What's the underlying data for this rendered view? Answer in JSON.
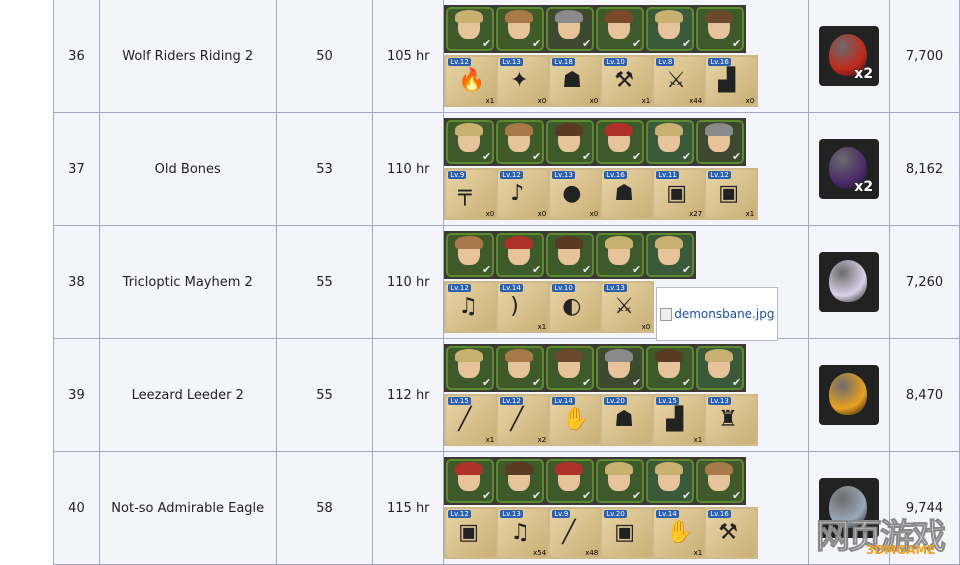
{
  "rows": [
    {
      "no": "36",
      "name": "Wolf Riders Riding 2",
      "level": "50",
      "time": "105 hr",
      "gold": "7,700",
      "heroes": [
        {
          "hair": "#c8b070",
          "bg": "#3f5a2a"
        },
        {
          "hair": "#a87a4a",
          "bg": "#405a2a"
        },
        {
          "hair": "#8a8a8a",
          "bg": "#3e4a30"
        },
        {
          "hair": "#7a4a2a",
          "bg": "#3f5a2a"
        },
        {
          "hair": "#c8b070",
          "bg": "#3a5a3a"
        },
        {
          "hair": "#6a4a2a",
          "bg": "#3f5a2a"
        }
      ],
      "items": [
        {
          "lv": "Lv.12",
          "icon": "flame-wand-icon",
          "glyph": "🔥",
          "qty": "x1"
        },
        {
          "lv": "Lv.13",
          "icon": "ice-wand-icon",
          "glyph": "✦",
          "qty": "x0"
        },
        {
          "lv": "Lv.18",
          "icon": "horned-helmet-icon",
          "glyph": "☗",
          "qty": "x0"
        },
        {
          "lv": "Lv.10",
          "icon": "battle-axe-icon",
          "glyph": "⚒",
          "qty": "x1"
        },
        {
          "lv": "Lv.8",
          "icon": "double-axe-icon",
          "glyph": "⚔",
          "qty": "x44"
        },
        {
          "lv": "Lv.16",
          "icon": "leather-boots-icon",
          "glyph": "▟",
          "qty": "x0"
        }
      ],
      "reward": {
        "icon": "red-crystal-icon",
        "color": "#c0281a",
        "mult": "x2"
      }
    },
    {
      "no": "37",
      "name": "Old Bones",
      "level": "53",
      "time": "110 hr",
      "gold": "8,162",
      "heroes": [
        {
          "hair": "#c8b070",
          "bg": "#3f5a2a"
        },
        {
          "hair": "#a87a4a",
          "bg": "#405a2a"
        },
        {
          "hair": "#5a3a20",
          "bg": "#3f5a2a"
        },
        {
          "hair": "#b0302a",
          "bg": "#3f5a2a"
        },
        {
          "hair": "#c8b070",
          "bg": "#3a5a3a"
        },
        {
          "hair": "#8a8a8a",
          "bg": "#3e4a30"
        }
      ],
      "items": [
        {
          "lv": "Lv.9",
          "icon": "pistol-icon",
          "glyph": "╤",
          "qty": "x0"
        },
        {
          "lv": "Lv.12",
          "icon": "lute-icon",
          "glyph": "♪",
          "qty": "x0"
        },
        {
          "lv": "Lv.13",
          "icon": "orb-staff-icon",
          "glyph": "●",
          "qty": "x0"
        },
        {
          "lv": "Lv.16",
          "icon": "golden-helmet-icon",
          "glyph": "☗",
          "qty": ""
        },
        {
          "lv": "Lv.11",
          "icon": "steel-armor-icon",
          "glyph": "▣",
          "qty": "x27"
        },
        {
          "lv": "Lv.12",
          "icon": "gold-armor-icon",
          "glyph": "▣",
          "qty": "x1"
        }
      ],
      "reward": {
        "icon": "purple-potion-icon",
        "color": "#4a2a6a",
        "mult": "x2"
      }
    },
    {
      "no": "38",
      "name": "Tricloptic Mayhem 2",
      "level": "55",
      "time": "110 hr",
      "gold": "7,260",
      "heroes": [
        {
          "hair": "#a87a4a",
          "bg": "#405a2a"
        },
        {
          "hair": "#b0302a",
          "bg": "#3f5a2a"
        },
        {
          "hair": "#5a3a20",
          "bg": "#3f5a2a"
        },
        {
          "hair": "#c8b070",
          "bg": "#3f5a2a"
        },
        {
          "hair": "#c8b070",
          "bg": "#3a5a3a"
        }
      ],
      "items": [
        {
          "lv": "Lv.12",
          "icon": "bagpipes-icon",
          "glyph": "♫",
          "qty": ""
        },
        {
          "lv": "Lv.14",
          "icon": "bow-icon",
          "glyph": ")",
          "qty": "x1"
        },
        {
          "lv": "Lv.10",
          "icon": "crescent-axe-icon",
          "glyph": "◐",
          "qty": ""
        },
        {
          "lv": "Lv.13",
          "icon": "serrated-sword-icon",
          "glyph": "⚔",
          "qty": "x0"
        }
      ],
      "broken_image": "demonsbane.jpg",
      "reward": {
        "icon": "crystal-prism-icon",
        "color": "#d9d0e8",
        "mult": ""
      }
    },
    {
      "no": "39",
      "name": "Leezard Leeder 2",
      "level": "55",
      "time": "112 hr",
      "gold": "8,470",
      "heroes": [
        {
          "hair": "#c8b070",
          "bg": "#3f5a2a"
        },
        {
          "hair": "#a87a4a",
          "bg": "#405a2a"
        },
        {
          "hair": "#6a4a2a",
          "bg": "#3f5a2a"
        },
        {
          "hair": "#8a8a8a",
          "bg": "#3e4a30"
        },
        {
          "hair": "#5a3a20",
          "bg": "#3f5a2a"
        },
        {
          "hair": "#c8b070",
          "bg": "#3a5a3a"
        }
      ],
      "items": [
        {
          "lv": "Lv.15",
          "icon": "bone-club-icon",
          "glyph": "╱",
          "qty": "x1"
        },
        {
          "lv": "Lv.12",
          "icon": "ice-sword-icon",
          "glyph": "╱",
          "qty": "x2"
        },
        {
          "lv": "Lv.14",
          "icon": "gauntlets-icon",
          "glyph": "✋",
          "qty": ""
        },
        {
          "lv": "Lv.20",
          "icon": "beast-helmet-icon",
          "glyph": "☗",
          "qty": ""
        },
        {
          "lv": "Lv.15",
          "icon": "greaves-icon",
          "glyph": "▟",
          "qty": "x1"
        },
        {
          "lv": "Lv.13",
          "icon": "purple-robe-icon",
          "glyph": "♜",
          "qty": ""
        }
      ],
      "reward": {
        "icon": "golden-leaf-icon",
        "color": "#e8a020",
        "mult": ""
      }
    },
    {
      "no": "40",
      "name": "Not-so Admirable Eagle",
      "level": "58",
      "time": "115 hr",
      "gold": "9,744",
      "heroes": [
        {
          "hair": "#b0302a",
          "bg": "#3f5a2a"
        },
        {
          "hair": "#5a3a20",
          "bg": "#3f5a2a"
        },
        {
          "hair": "#b0302a",
          "bg": "#3f5a2a"
        },
        {
          "hair": "#c8b070",
          "bg": "#3f5a2a"
        },
        {
          "hair": "#c8b070",
          "bg": "#3a5a3a"
        },
        {
          "hair": "#a87a4a",
          "bg": "#405a2a"
        }
      ],
      "items": [
        {
          "lv": "Lv.12",
          "icon": "leather-armor-icon",
          "glyph": "▣",
          "qty": ""
        },
        {
          "lv": "Lv.13",
          "icon": "bagpipes-icon",
          "glyph": "♫",
          "qty": "x54"
        },
        {
          "lv": "Lv.9",
          "icon": "stone-hammer-icon",
          "glyph": "╱",
          "qty": "x48"
        },
        {
          "lv": "Lv.20",
          "icon": "red-armor-icon",
          "glyph": "▣",
          "qty": ""
        },
        {
          "lv": "Lv.14",
          "icon": "spiked-gauntlet-icon",
          "glyph": "✋",
          "qty": "x1"
        },
        {
          "lv": "Lv.16",
          "icon": "golden-axe-icon",
          "glyph": "⚒",
          "qty": ""
        }
      ],
      "reward": {
        "icon": "steel-gear-icon",
        "color": "#9aa8b8",
        "mult": ""
      }
    }
  ],
  "watermark": {
    "text": "网页游戏",
    "sub": "3DMGAME"
  }
}
